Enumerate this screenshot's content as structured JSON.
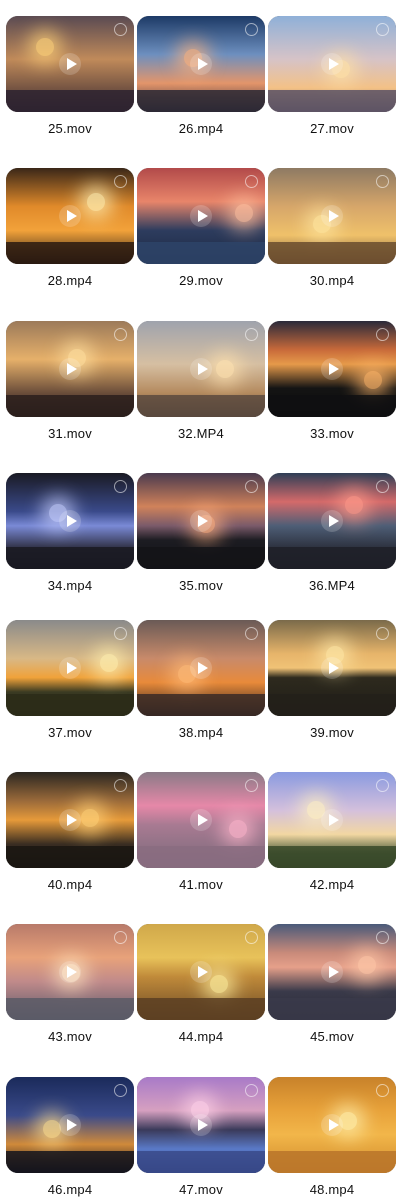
{
  "videos": [
    {
      "name": "25.mov",
      "sky": "linear-gradient(180deg,#5a4a52 0%,#c08a5a 45%,#3a2a30 100%)",
      "ground": "#2b2230",
      "sun": "#ffd37a"
    },
    {
      "name": "26.mp4",
      "sky": "linear-gradient(180deg,#1d3a66 0%,#6d8fbf 40%,#e3956a 70%,#3a2f3c 100%)",
      "ground": "#2a2834",
      "sun": "#ffb27a"
    },
    {
      "name": "27.mov",
      "sky": "linear-gradient(180deg,#8fb0d8 0%,#d6c3c7 45%,#f3c186 75%,#6e5a62 100%)",
      "ground": "#5b5265",
      "sun": "#ffe2a6"
    },
    {
      "name": "28.mp4",
      "sky": "linear-gradient(180deg,#3a2718 0%,#e08a2a 40%,#f2a23a 65%,#2a1c14 100%)",
      "ground": "#2a1a10",
      "sun": "#fff1b5"
    },
    {
      "name": "29.mov",
      "sky": "linear-gradient(180deg,#b24a4a 0%,#e8856a 35%,#2d3c5e 65%,#1c2842 100%)",
      "ground": "#2e4468",
      "sun": "#ffc2a0"
    },
    {
      "name": "30.mp4",
      "sky": "linear-gradient(180deg,#8e7a63 0%,#d6a66a 40%,#efc16a 70%,#7a5a3a 100%)",
      "ground": "#6a4c2e",
      "sun": "#ffe7a2"
    },
    {
      "name": "31.mov",
      "sky": "linear-gradient(180deg,#9c7a5a 0%,#e6b06a 40%,#6a4d3a 75%,#2c201c 100%)",
      "ground": "#2a1f1c",
      "sun": "#ffe0a0"
    },
    {
      "name": "32.MP4",
      "sky": "linear-gradient(180deg,#9fa3ad 0%,#d6bfa2 45%,#b48a5e 75%,#4a3e3a 100%)",
      "ground": "#5c4a3e",
      "sun": "#ffe3b0"
    },
    {
      "name": "33.mov",
      "sky": "linear-gradient(180deg,#2a2a3a 0%,#c86a3a 30%,#e69a4a 45%,#141414 70%,#0c0c0c 100%)",
      "ground": "#0f0f12",
      "sun": "#ffb66a"
    },
    {
      "name": "34.mp4",
      "sky": "linear-gradient(180deg,#1a1a24 0%,#3a4a8a 40%,#7a8ad6 55%,#2a2a3a 80%,#14141c 100%)",
      "ground": "#1a1a22",
      "sun": "#c8d0ff"
    },
    {
      "name": "35.mov",
      "sky": "linear-gradient(180deg,#4a3a4e 0%,#d0825a 35%,#7a5a6a 55%,#1c1c22 70%,#121216 100%)",
      "ground": "#141418",
      "sun": "#ffb080"
    },
    {
      "name": "36.MP4",
      "sky": "linear-gradient(180deg,#2e3e56 0%,#d46a6a 30%,#4e5e76 55%,#2a2e3a 80%,#1a1c24 100%)",
      "ground": "#1e2028",
      "sun": "#ff9a8a"
    },
    {
      "name": "37.mov",
      "sky": "linear-gradient(180deg,#8a8a8a 0%,#d8b886 40%,#f0a23a 60%,#3a3a22 75%,#2a2a1a 100%)",
      "ground": "#2c2c18",
      "sun": "#fff0b0"
    },
    {
      "name": "38.mp4",
      "sky": "linear-gradient(180deg,#6a5a56 0%,#c88a6a 40%,#e88a3a 65%,#2a1e1c 100%)",
      "ground": "#3a2a26",
      "sun": "#ffbc7a"
    },
    {
      "name": "39.mov",
      "sky": "linear-gradient(180deg,#7a6a4a 0%,#e6b46a 35%,#f0c276 50%,#2e2a1e 60%,#1e1c16 100%)",
      "ground": "#23201a",
      "sun": "#ffe9a8"
    },
    {
      "name": "40.mp4",
      "sky": "linear-gradient(180deg,#2a2620 0%,#9a6a3a 30%,#e69a3a 50%,#3a2e22 75%,#1a1612 100%)",
      "ground": "#1a1612",
      "sun": "#ffd27a"
    },
    {
      "name": "41.mov",
      "sky": "linear-gradient(180deg,#8a7a86 0%,#e688a8 35%,#a87a92 55%,#7a6a7a 100%)",
      "ground": "#8a6c80",
      "sun": "#ffb6cc"
    },
    {
      "name": "42.mp4",
      "sky": "linear-gradient(180deg,#8a9ae0 0%,#d4c0dc 40%,#f2d7a2 65%,#4a5a3a 85%,#2a3a22 100%)",
      "ground": "#3a4a2a",
      "sun": "#fff2c0"
    },
    {
      "name": "43.mov",
      "sky": "linear-gradient(180deg,#b87a6a 0%,#e8a27a 35%,#c08a8a 60%,#5a5a6a 100%)",
      "ground": "#5a5a66",
      "sun": "#ffe6c0"
    },
    {
      "name": "44.mp4",
      "sky": "linear-gradient(180deg,#d0a84a 0%,#e8c25a 35%,#c08a3a 55%,#6a4a26 100%)",
      "ground": "#5a3e22",
      "sun": "#fff0a0"
    },
    {
      "name": "45.mov",
      "sky": "linear-gradient(180deg,#4a5a7a 0%,#c88a7a 30%,#e6a08a 45%,#3a3a4a 70%,#2a2a36 100%)",
      "ground": "#3a3a4a",
      "sun": "#ffc8a8"
    },
    {
      "name": "46.mp4",
      "sky": "linear-gradient(180deg,#1a2a5a 0%,#3a4a8a 40%,#d08a3a 70%,#141420 100%)",
      "ground": "#14141c",
      "sun": "#ffe090"
    },
    {
      "name": "47.mov",
      "sky": "linear-gradient(180deg,#a87ac8 0%,#d6a0c0 35%,#3a3a5a 55%,#5a7ac8 75%,#2a3a7a 100%)",
      "ground": "#3a4a8a",
      "sun": "#ffd2e8"
    },
    {
      "name": "48.mp4",
      "sky": "linear-gradient(180deg,#c8822a 0%,#e8a23a 35%,#f2b64a 60%,#d08a2a 100%)",
      "ground": "#b8742a",
      "sun": "#fff2b0"
    }
  ]
}
